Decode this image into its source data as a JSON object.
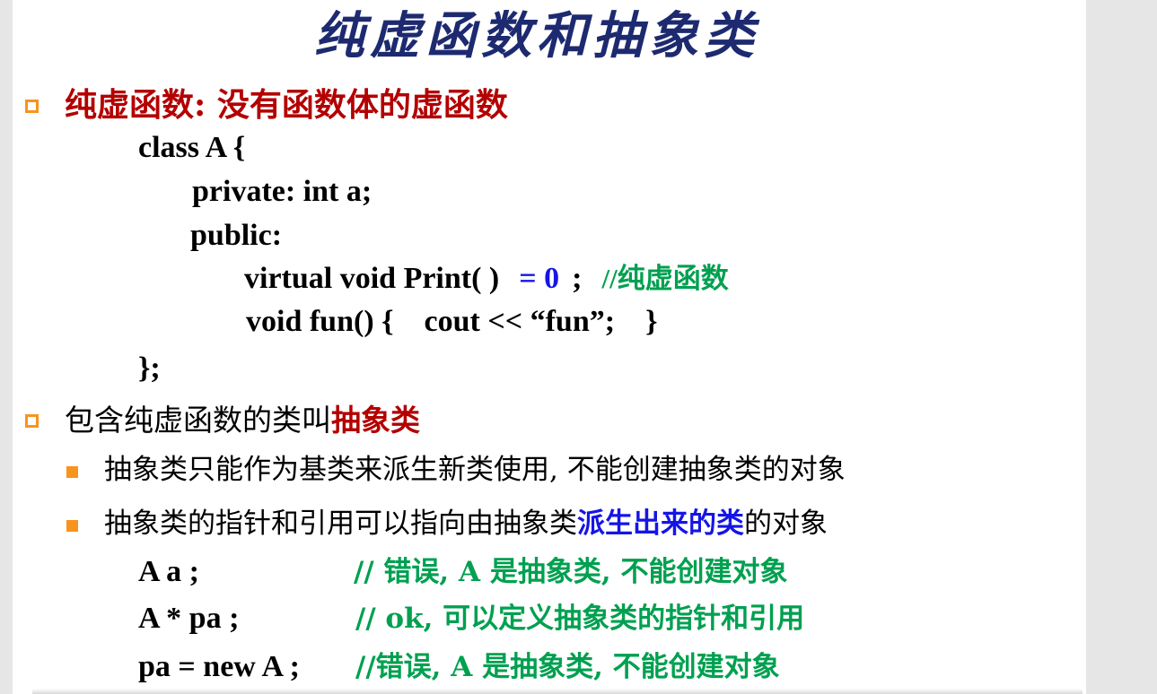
{
  "slide": {
    "title": "纯虚函数和抽象类",
    "point1": {
      "label": "纯虚函数: 没有函数体的虚函数"
    },
    "code": {
      "line1": "class A {",
      "line2": "private:  int a;",
      "line3": "public:",
      "line4_code": "virtual void Print( )",
      "line4_eq": "= 0",
      "line4_semi": ";",
      "line4_comment": "//纯虚函数",
      "line5": "void fun() {    cout << “fun”;    }",
      "line6": "};"
    },
    "point2": {
      "prefix": "包含纯虚函数的类叫",
      "highlight": "抽象类"
    },
    "sub1": {
      "text": "抽象类只能作为基类来派生新类使用, 不能创建抽象类的对象"
    },
    "sub2": {
      "prefix": "抽象类的指针和引用可以指向由抽象类",
      "highlight": "派生出来的类",
      "suffix": "的对象"
    },
    "examples": [
      {
        "code": "A a ;",
        "comment": "// 错误, A 是抽象类, 不能创建对象"
      },
      {
        "code": "A * pa ;",
        "comment": "// ok, 可以定义抽象类的指针和引用"
      },
      {
        "code": "pa = new A ;",
        "comment": "//错误, A 是抽象类, 不能创建对象"
      }
    ]
  },
  "colors": {
    "title": "#1d2a70",
    "heading_red": "#b30000",
    "comment_green": "#00a050",
    "highlight_blue": "#1515e6",
    "bullet_orange": "#f7941d"
  }
}
